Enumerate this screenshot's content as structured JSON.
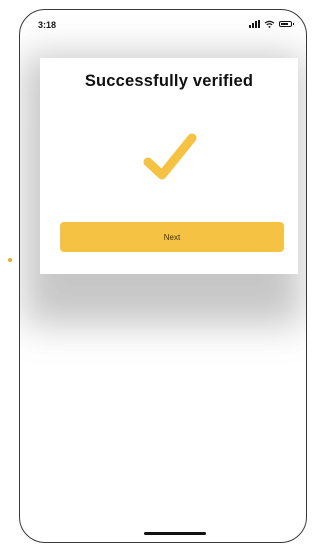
{
  "status_bar": {
    "time": "3:18"
  },
  "dialog": {
    "title": "Successfully verified",
    "check_icon": "checkmark-icon",
    "next_label": "Next"
  },
  "colors": {
    "accent": "#f5c243",
    "text": "#111111"
  }
}
